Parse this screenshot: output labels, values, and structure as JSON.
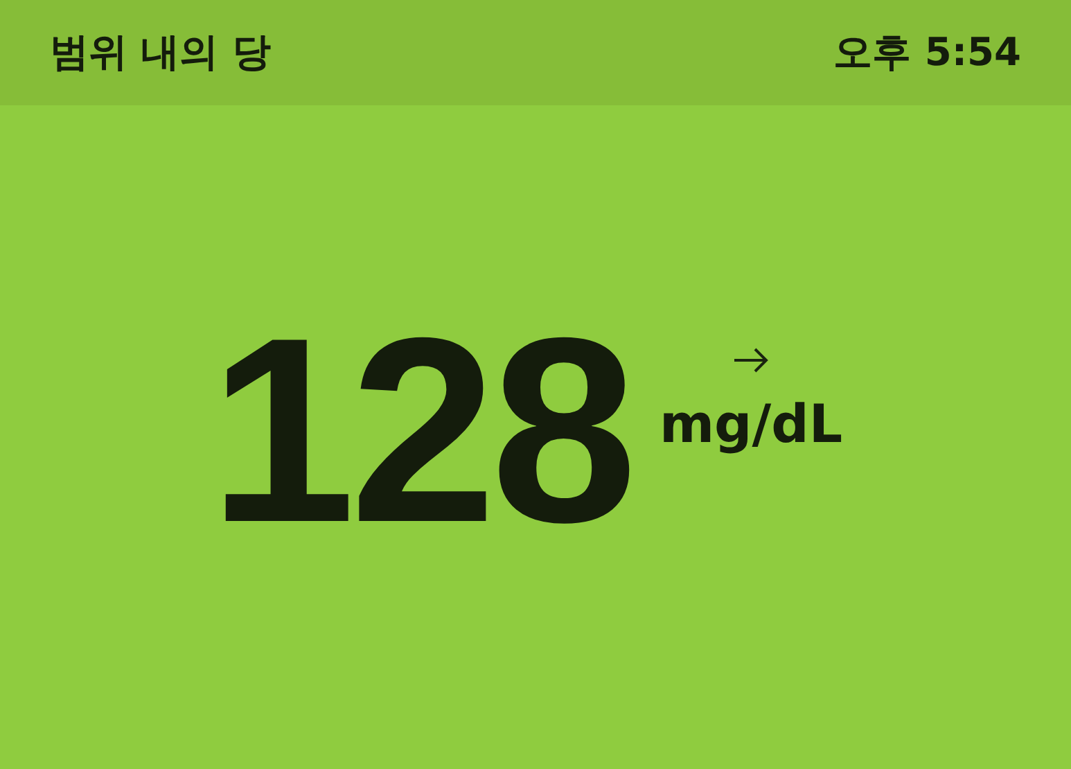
{
  "header": {
    "title": "범위 내의 당",
    "time": "오후 5:54"
  },
  "reading": {
    "value": "128",
    "unit": "mg/dL"
  }
}
